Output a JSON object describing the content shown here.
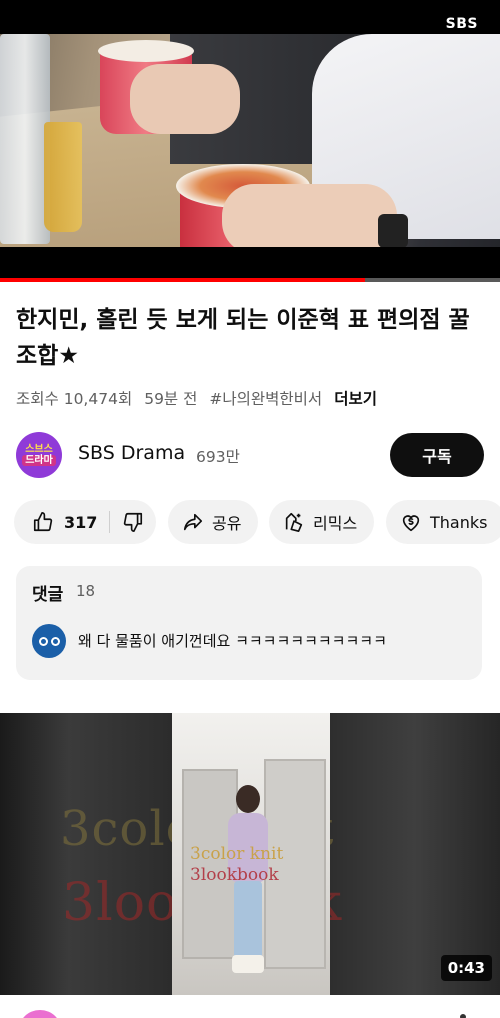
{
  "player": {
    "channel_watermark": "SBS",
    "progress_fraction": 0.73
  },
  "video": {
    "title": "한지민, 홀린 듯 보게 되는 이준혁 표 편의점 꿀 조합★",
    "views": "조회수 10,474회",
    "age": "59분 전",
    "hashtag": "#나의완벽한비서",
    "more_label": "더보기"
  },
  "channel": {
    "avatar_line1": "스브스",
    "avatar_line2": "드라마",
    "name": "SBS Drama",
    "subscribers": "693만",
    "subscribe_label": "구독"
  },
  "actions": {
    "like_count": "317",
    "share_label": "공유",
    "remix_label": "리믹스",
    "thanks_label": "Thanks"
  },
  "comments": {
    "heading": "댓글",
    "count": "18",
    "top_comment": "왜 다 물품이 애기껀데요 ㅋㅋㅋㅋㅋㅋㅋㅋㅋㅋㅋ"
  },
  "next_video": {
    "overlay_text_1": "3color knit",
    "overlay_text_2": "3lookbook",
    "bg_text_1": "3color knit",
    "bg_text_2": "3lookbook",
    "duration": "0:43"
  },
  "colors": {
    "accent_red": "#ff0000",
    "chip_bg": "#f2f2f2",
    "text_primary": "#0f0f0f",
    "text_secondary": "#606060"
  }
}
